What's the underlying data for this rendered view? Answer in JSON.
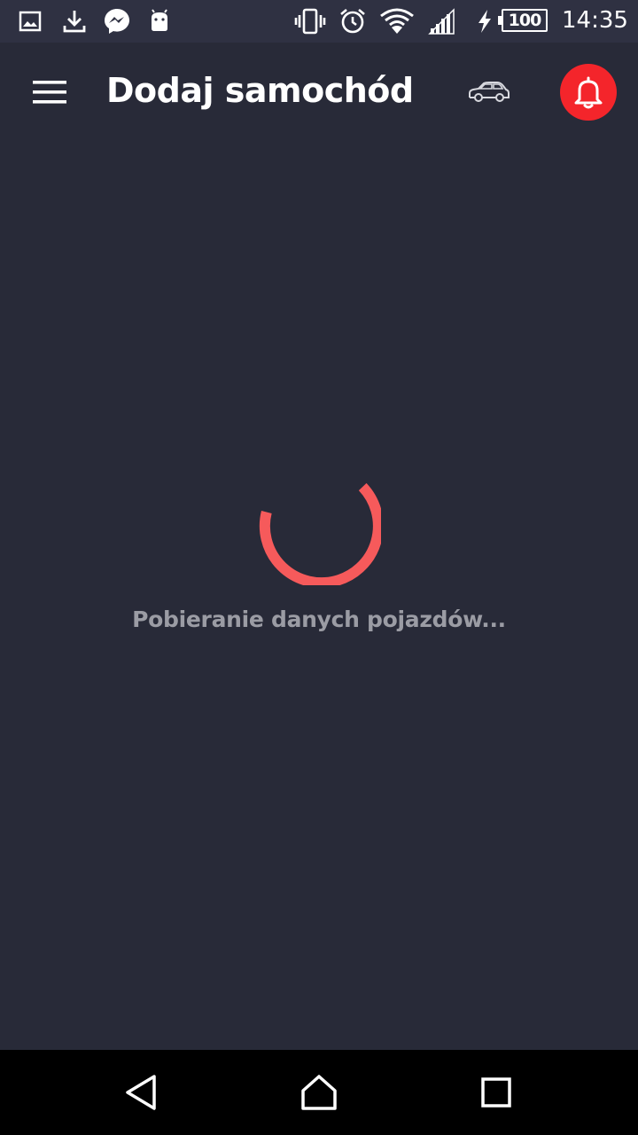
{
  "status_bar": {
    "icons": [
      "image-icon",
      "download-icon",
      "messenger-icon",
      "android-icon",
      "vibrate-icon",
      "alarm-icon",
      "wifi-icon",
      "signal-icon",
      "charging-icon"
    ],
    "battery": "100",
    "time": "14:35"
  },
  "app_bar": {
    "title": "Dodaj samochód",
    "menu_icon": "hamburger-menu-icon",
    "car_icon": "car-icon",
    "bell_icon": "bell-icon"
  },
  "loading": {
    "text": "Pobieranie danych pojazdów...",
    "spinner_icon": "loading-spinner-icon"
  },
  "nav_bar": {
    "icons": [
      "back-icon",
      "home-icon",
      "recents-icon"
    ]
  },
  "colors": {
    "background": "#282a38",
    "status_bar": "#2f3142",
    "accent": "#f65a5b",
    "bell_bg": "#f4252b",
    "loading_text": "#9b9ca4"
  }
}
